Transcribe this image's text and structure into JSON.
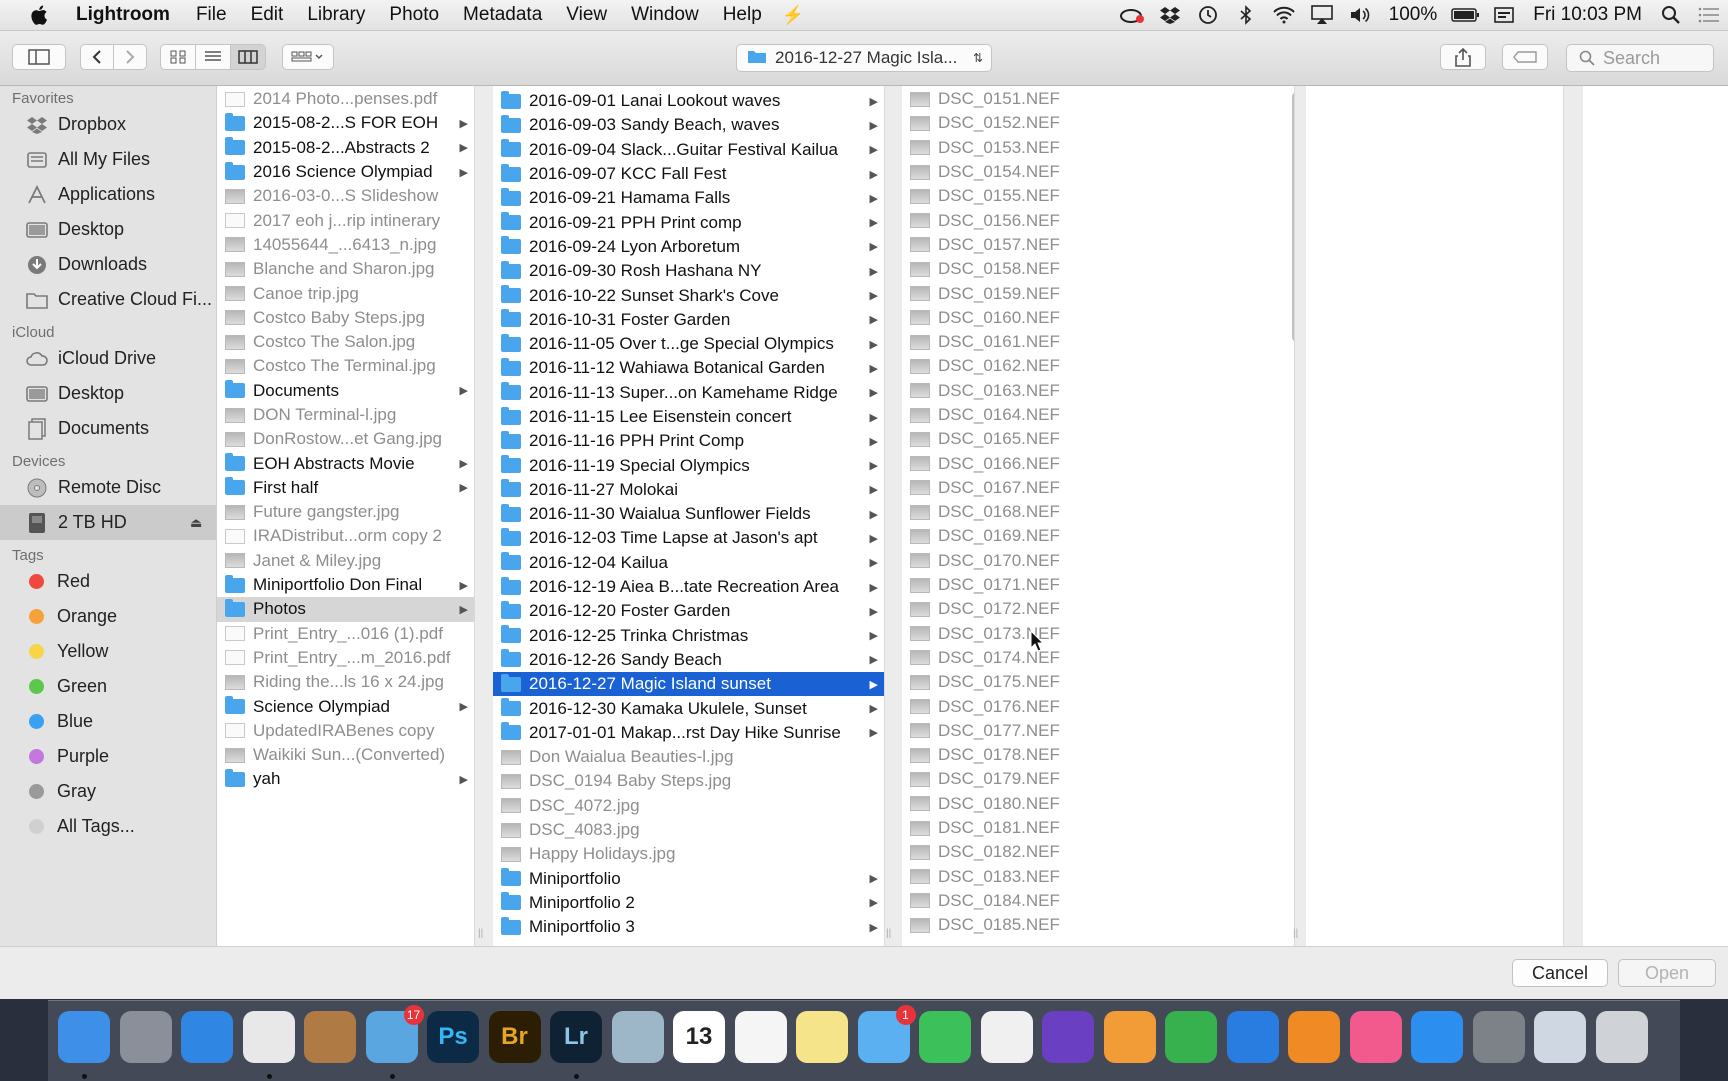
{
  "menubar": {
    "app_name": "Lightroom",
    "items": [
      "File",
      "Edit",
      "Library",
      "Photo",
      "Metadata",
      "View",
      "Window",
      "Help"
    ],
    "battery": "100%",
    "clock": "Fri 10:03 PM"
  },
  "toolbar": {
    "path": "2016-12-27 Magic Isla...",
    "search_placeholder": "Search"
  },
  "sidebar": {
    "favorites_header": "Favorites",
    "favorites": [
      "Dropbox",
      "All My Files",
      "Applications",
      "Desktop",
      "Downloads",
      "Creative Cloud Fi..."
    ],
    "icloud_header": "iCloud",
    "icloud": [
      "iCloud Drive",
      "Desktop",
      "Documents"
    ],
    "devices_header": "Devices",
    "devices": [
      "Remote Disc",
      "2 TB HD"
    ],
    "tags_header": "Tags",
    "tags": [
      {
        "label": "Red",
        "color": "#f0483e"
      },
      {
        "label": "Orange",
        "color": "#f6a23b"
      },
      {
        "label": "Yellow",
        "color": "#f8d548"
      },
      {
        "label": "Green",
        "color": "#5bc74c"
      },
      {
        "label": "Blue",
        "color": "#3aa0f2"
      },
      {
        "label": "Purple",
        "color": "#c478df"
      },
      {
        "label": "Gray",
        "color": "#9a9a9a"
      },
      {
        "label": "All Tags...",
        "color": "#d0d0d0"
      }
    ]
  },
  "column1": [
    {
      "name": "2014 Photo...penses.pdf",
      "kind": "doc"
    },
    {
      "name": "2015-08-2...S FOR EOH",
      "kind": "folder"
    },
    {
      "name": "2015-08-2...Abstracts 2",
      "kind": "folder"
    },
    {
      "name": "2016 Science Olympiad",
      "kind": "folder"
    },
    {
      "name": "2016-03-0...S Slideshow",
      "kind": "file"
    },
    {
      "name": "2017 eoh j...rip intinerary",
      "kind": "doc"
    },
    {
      "name": "14055644_...6413_n.jpg",
      "kind": "file"
    },
    {
      "name": "Blanche and Sharon.jpg",
      "kind": "file"
    },
    {
      "name": "Canoe trip.jpg",
      "kind": "file"
    },
    {
      "name": "Costco Baby Steps.jpg",
      "kind": "file"
    },
    {
      "name": "Costco The Salon.jpg",
      "kind": "file"
    },
    {
      "name": "Costco The Terminal.jpg",
      "kind": "file"
    },
    {
      "name": "Documents",
      "kind": "folder"
    },
    {
      "name": "DON Terminal-l.jpg",
      "kind": "file"
    },
    {
      "name": "DonRostow...et Gang.jpg",
      "kind": "file"
    },
    {
      "name": "EOH Abstracts Movie",
      "kind": "folder"
    },
    {
      "name": "First half",
      "kind": "folder"
    },
    {
      "name": "Future gangster.jpg",
      "kind": "file"
    },
    {
      "name": "IRADistribut...orm copy 2",
      "kind": "doc"
    },
    {
      "name": "Janet & Miley.jpg",
      "kind": "file"
    },
    {
      "name": "Miniportfolio Don Final",
      "kind": "folder"
    },
    {
      "name": "Photos",
      "kind": "folder",
      "selected": "gray"
    },
    {
      "name": "Print_Entry_...016 (1).pdf",
      "kind": "doc"
    },
    {
      "name": "Print_Entry_...m_2016.pdf",
      "kind": "doc"
    },
    {
      "name": "Riding the...ls 16 x 24.jpg",
      "kind": "file"
    },
    {
      "name": "Science Olympiad",
      "kind": "folder"
    },
    {
      "name": "UpdatedIRABenes copy",
      "kind": "doc"
    },
    {
      "name": "Waikiki Sun...(Converted)",
      "kind": "file"
    },
    {
      "name": "yah",
      "kind": "folder"
    }
  ],
  "column2": [
    {
      "name": "2016-09-01 Lanai Lookout waves",
      "kind": "folder"
    },
    {
      "name": "2016-09-03 Sandy Beach, waves",
      "kind": "folder"
    },
    {
      "name": "2016-09-04 Slack...Guitar Festival Kailua",
      "kind": "folder"
    },
    {
      "name": "2016-09-07 KCC Fall Fest",
      "kind": "folder"
    },
    {
      "name": "2016-09-21 Hamama Falls",
      "kind": "folder"
    },
    {
      "name": "2016-09-21 PPH Print comp",
      "kind": "folder"
    },
    {
      "name": "2016-09-24 Lyon Arboretum",
      "kind": "folder"
    },
    {
      "name": "2016-09-30 Rosh Hashana NY",
      "kind": "folder"
    },
    {
      "name": "2016-10-22 Sunset Shark's Cove",
      "kind": "folder"
    },
    {
      "name": "2016-10-31 Foster Garden",
      "kind": "folder"
    },
    {
      "name": "2016-11-05 Over t...ge Special Olympics",
      "kind": "folder"
    },
    {
      "name": "2016-11-12 Wahiawa Botanical Garden",
      "kind": "folder"
    },
    {
      "name": "2016-11-13 Super...on Kamehame Ridge",
      "kind": "folder"
    },
    {
      "name": "2016-11-15 Lee Eisenstein concert",
      "kind": "folder"
    },
    {
      "name": "2016-11-16 PPH Print Comp",
      "kind": "folder"
    },
    {
      "name": "2016-11-19 Special Olympics",
      "kind": "folder"
    },
    {
      "name": "2016-11-27 Molokai",
      "kind": "folder"
    },
    {
      "name": "2016-11-30 Waialua Sunflower Fields",
      "kind": "folder"
    },
    {
      "name": "2016-12-03 Time Lapse at Jason's apt",
      "kind": "folder"
    },
    {
      "name": "2016-12-04 Kailua",
      "kind": "folder"
    },
    {
      "name": "2016-12-19 Aiea B...tate Recreation Area",
      "kind": "folder"
    },
    {
      "name": "2016-12-20 Foster Garden",
      "kind": "folder"
    },
    {
      "name": "2016-12-25 Trinka Christmas",
      "kind": "folder"
    },
    {
      "name": "2016-12-26 Sandy Beach",
      "kind": "folder"
    },
    {
      "name": "2016-12-27 Magic Island sunset",
      "kind": "folder",
      "selected": "blue"
    },
    {
      "name": "2016-12-30 Kamaka Ukulele, Sunset",
      "kind": "folder"
    },
    {
      "name": "2017-01-01 Makap...rst Day Hike Sunrise",
      "kind": "folder"
    },
    {
      "name": "Don Waialua Beauties-l.jpg",
      "kind": "file"
    },
    {
      "name": "DSC_0194 Baby Steps.jpg",
      "kind": "file"
    },
    {
      "name": "DSC_4072.jpg",
      "kind": "file"
    },
    {
      "name": "DSC_4083.jpg",
      "kind": "file"
    },
    {
      "name": "Happy Holidays.jpg",
      "kind": "file"
    },
    {
      "name": "Miniportfolio",
      "kind": "folder"
    },
    {
      "name": "Miniportfolio 2",
      "kind": "folder"
    },
    {
      "name": "Miniportfolio 3",
      "kind": "folder"
    }
  ],
  "column3": [
    "DSC_0151.NEF",
    "DSC_0152.NEF",
    "DSC_0153.NEF",
    "DSC_0154.NEF",
    "DSC_0155.NEF",
    "DSC_0156.NEF",
    "DSC_0157.NEF",
    "DSC_0158.NEF",
    "DSC_0159.NEF",
    "DSC_0160.NEF",
    "DSC_0161.NEF",
    "DSC_0162.NEF",
    "DSC_0163.NEF",
    "DSC_0164.NEF",
    "DSC_0165.NEF",
    "DSC_0166.NEF",
    "DSC_0167.NEF",
    "DSC_0168.NEF",
    "DSC_0169.NEF",
    "DSC_0170.NEF",
    "DSC_0171.NEF",
    "DSC_0172.NEF",
    "DSC_0173.NEF",
    "DSC_0174.NEF",
    "DSC_0175.NEF",
    "DSC_0176.NEF",
    "DSC_0177.NEF",
    "DSC_0178.NEF",
    "DSC_0179.NEF",
    "DSC_0180.NEF",
    "DSC_0181.NEF",
    "DSC_0182.NEF",
    "DSC_0183.NEF",
    "DSC_0184.NEF",
    "DSC_0185.NEF"
  ],
  "buttons": {
    "cancel": "Cancel",
    "open": "Open"
  },
  "dock": [
    {
      "name": "finder",
      "color": "#3d8fe8",
      "label": "",
      "running": true
    },
    {
      "name": "launchpad",
      "color": "#8a8f99",
      "label": ""
    },
    {
      "name": "safari",
      "color": "#2f86e3",
      "label": ""
    },
    {
      "name": "chrome",
      "color": "#e8e8e8",
      "label": "",
      "running": true
    },
    {
      "name": "contacts",
      "color": "#b07a45",
      "label": ""
    },
    {
      "name": "mail",
      "color": "#5aa6e0",
      "label": "",
      "badge": "17",
      "running": true
    },
    {
      "name": "photoshop",
      "color": "#0c2a45",
      "label": "Ps",
      "text_color": "#35b7f5"
    },
    {
      "name": "bridge",
      "color": "#2b1e05",
      "label": "Br",
      "text_color": "#e6a622"
    },
    {
      "name": "lightroom",
      "color": "#0f2233",
      "label": "Lr",
      "text_color": "#8fc3e8",
      "running": true
    },
    {
      "name": "preview",
      "color": "#9db7c8",
      "label": ""
    },
    {
      "name": "calendar",
      "color": "#ffffff",
      "label": "13",
      "text_color": "#222"
    },
    {
      "name": "reminders",
      "color": "#f5f5f5",
      "label": ""
    },
    {
      "name": "notes",
      "color": "#f6e48a",
      "label": ""
    },
    {
      "name": "messages",
      "color": "#5ab0f0",
      "label": "",
      "badge": "1"
    },
    {
      "name": "facetime",
      "color": "#3cc15a",
      "label": ""
    },
    {
      "name": "photos",
      "color": "#f0f0f0",
      "label": ""
    },
    {
      "name": "imovie",
      "color": "#6a3fc2",
      "label": ""
    },
    {
      "name": "pages",
      "color": "#f29c38",
      "label": ""
    },
    {
      "name": "numbers",
      "color": "#37b14d",
      "label": ""
    },
    {
      "name": "keynote",
      "color": "#2a7de0",
      "label": ""
    },
    {
      "name": "ibooks",
      "color": "#f08a24",
      "label": ""
    },
    {
      "name": "itunes",
      "color": "#f25a8e",
      "label": ""
    },
    {
      "name": "app-store",
      "color": "#2c8ff0",
      "label": ""
    },
    {
      "name": "system-preferences",
      "color": "#7d8188",
      "label": ""
    },
    {
      "name": "downloads-stack",
      "color": "#cfd7e3",
      "label": ""
    },
    {
      "name": "trash",
      "color": "#cfd3d8",
      "label": ""
    }
  ]
}
